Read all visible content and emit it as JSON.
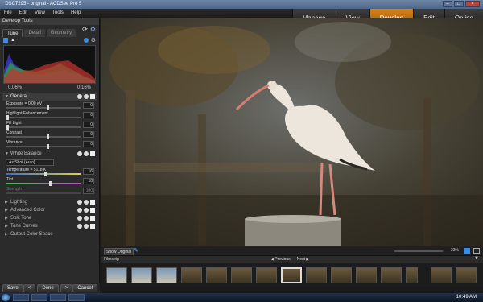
{
  "window": {
    "title": "_DSC7295 - original - ACDSee Pro 5"
  },
  "menu": [
    "File",
    "Edit",
    "View",
    "Tools",
    "Help"
  ],
  "modes": [
    {
      "label": "Manage",
      "active": false
    },
    {
      "label": "View",
      "active": false
    },
    {
      "label": "Develop",
      "active": true
    },
    {
      "label": "Edit",
      "active": false
    },
    {
      "label": "Online",
      "active": false
    }
  ],
  "left": {
    "panel_title": "Develop Tools",
    "tabs": [
      "Tune",
      "Detail",
      "Geometry"
    ],
    "clip_left": "0.06%",
    "clip_right": "0.16%",
    "general": {
      "title": "General",
      "sliders": [
        {
          "label": "Exposure = 0.00 eV",
          "value": "0"
        },
        {
          "label": "Highlight Enhancement",
          "value": "0"
        },
        {
          "label": "Fill Light",
          "value": "0"
        },
        {
          "label": "Contrast",
          "value": "0"
        },
        {
          "label": "Vibrance",
          "value": "0"
        }
      ]
    },
    "white_balance": {
      "title": "White Balance",
      "preset": "As Shot (Auto)",
      "sliders": [
        {
          "label": "Temperature = 5118 K",
          "value": "16"
        },
        {
          "label": "Tint",
          "value": "10"
        },
        {
          "label": "Strength",
          "value": "100"
        }
      ]
    },
    "collapsed": [
      "Lighting",
      "Advanced Color",
      "Split Tone",
      "Tone Curves",
      "Output Color Space"
    ],
    "buttons": {
      "save": "Save",
      "done": "Done",
      "cancel": "Cancel"
    }
  },
  "viewer": {
    "show_original": "Show Original",
    "zoom": "23%"
  },
  "filmstrip": {
    "label": "Filmstrip",
    "previous": "Previous",
    "next": "Next",
    "thumb_count": 15,
    "selected_index": 7
  },
  "taskbar": {
    "clock": "10:49 AM"
  }
}
